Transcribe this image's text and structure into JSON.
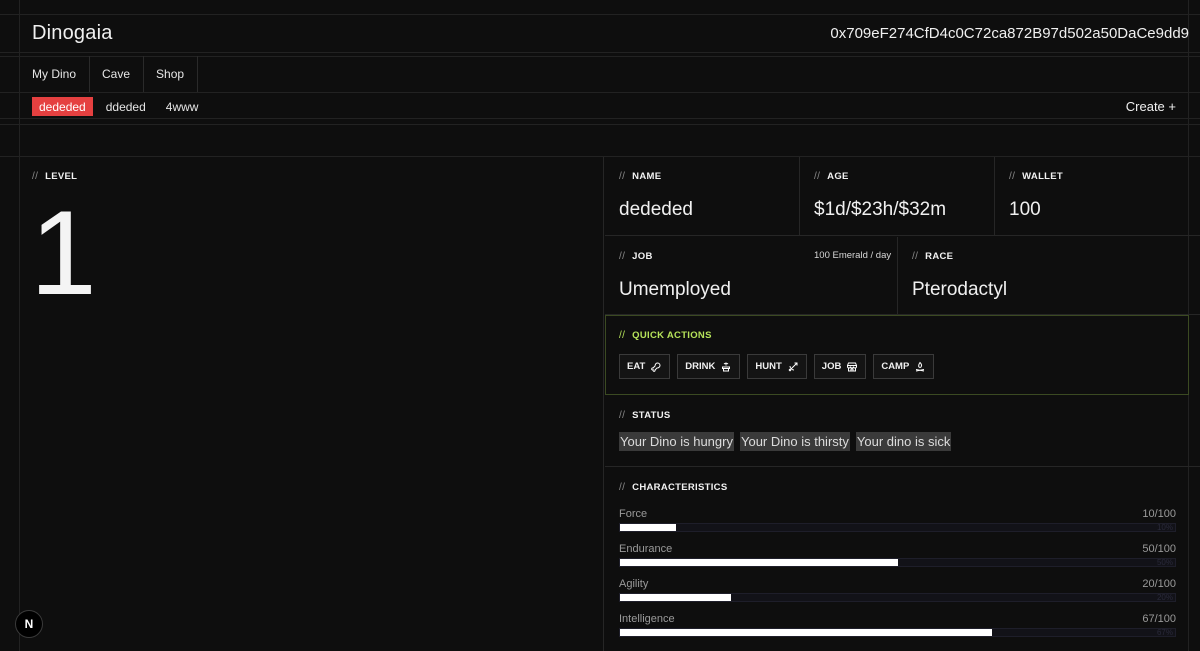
{
  "header": {
    "brand": "Dinogaia",
    "wallet_address": "0x709eF274CfD4c0C72ca872B97d502a50DaCe9dd9"
  },
  "nav": {
    "items": [
      {
        "label": "My Dino"
      },
      {
        "label": "Cave"
      },
      {
        "label": "Shop"
      }
    ]
  },
  "dinos": {
    "tabs": [
      {
        "label": "dededed",
        "active": true
      },
      {
        "label": "ddeded"
      },
      {
        "label": "4www"
      }
    ],
    "create_label": "Create +"
  },
  "level": {
    "label": "LEVEL",
    "value": "1"
  },
  "info": {
    "name": {
      "label": "NAME",
      "value": "dededed"
    },
    "age": {
      "label": "AGE",
      "value": "$1d/$23h/$32m"
    },
    "wallet": {
      "label": "WALLET",
      "value": "100"
    },
    "job": {
      "label": "JOB",
      "value": "Umemployed",
      "rate": "100 Emerald / day"
    },
    "race": {
      "label": "RACE",
      "value": "Pterodactyl"
    }
  },
  "quick_actions": {
    "label": "QUICK ACTIONS",
    "accent_color": "#b6e35a",
    "buttons": [
      {
        "label": "EAT",
        "icon": "drumstick-icon"
      },
      {
        "label": "DRINK",
        "icon": "fountain-icon"
      },
      {
        "label": "HUNT",
        "icon": "bow-arrow-icon"
      },
      {
        "label": "JOB",
        "icon": "store-icon"
      },
      {
        "label": "CAMP",
        "icon": "campfire-icon"
      }
    ]
  },
  "status": {
    "label": "STATUS",
    "items": [
      "Your Dino is hungry",
      "Your Dino is thirsty",
      "Your dino is sick"
    ]
  },
  "characteristics": {
    "label": "CHARACTERISTICS",
    "items": [
      {
        "name": "Force",
        "score": "10/100",
        "pct": "10%",
        "value": 10
      },
      {
        "name": "Endurance",
        "score": "50/100",
        "pct": "50%",
        "value": 50
      },
      {
        "name": "Agility",
        "score": "20/100",
        "pct": "20%",
        "value": 20
      },
      {
        "name": "Intelligence",
        "score": "67/100",
        "pct": "67%",
        "value": 67
      }
    ]
  },
  "active_tab_color": "#e54040",
  "badge": {
    "label": "N"
  }
}
